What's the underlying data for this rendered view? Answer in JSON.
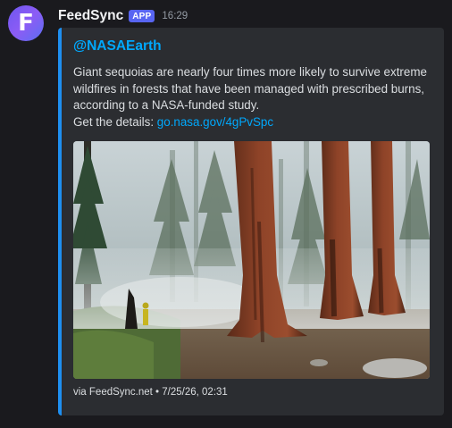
{
  "message": {
    "avatar_letter": "F",
    "username": "FeedSync",
    "badge": "APP",
    "timestamp": "16:29"
  },
  "embed": {
    "accent_color": "#1e8ff0",
    "author": "@NASAEarth",
    "description_lines": [
      "Giant sequoias are nearly four times more likely to survive extreme",
      "wildfires in forests that have been managed with prescribed burns,",
      "according to a NASA-funded study."
    ],
    "details_prefix": "Get the details: ",
    "details_link": "go.nasa.gov/4gPvSpc",
    "footer": "via FeedSync.net • 7/25/26, 02:31"
  },
  "colors": {
    "background": "#1a1a1e",
    "embed_bg": "#2b2d31",
    "link": "#00a8fc",
    "badge": "#5865f2"
  }
}
